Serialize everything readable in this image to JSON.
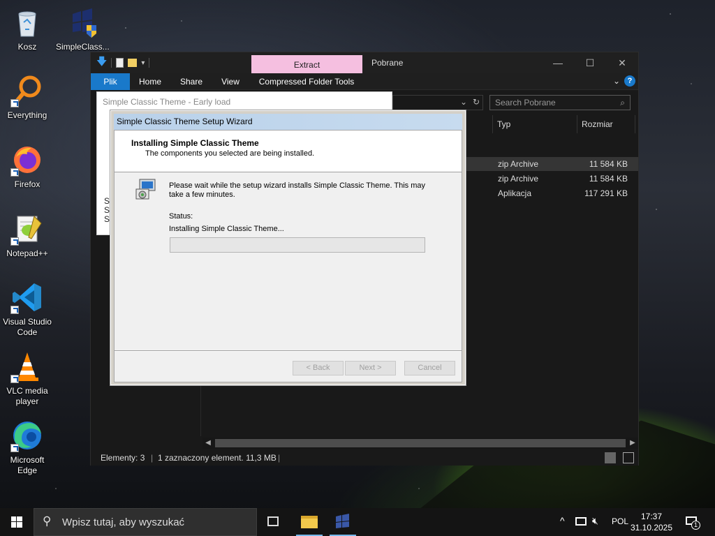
{
  "desktop": {
    "icons": [
      {
        "label": "Kosz"
      },
      {
        "label": "SimpleClass..."
      },
      {
        "label": "Everything"
      },
      {
        "label": "Firefox"
      },
      {
        "label": "Notepad++"
      },
      {
        "label": "Visual Studio Code"
      },
      {
        "label": "VLC media player"
      },
      {
        "label": "Microsoft Edge"
      }
    ]
  },
  "explorer": {
    "title": "Pobrane",
    "contextual_tab": "Extract",
    "ribbon_tabs": [
      "Plik",
      "Home",
      "Share",
      "View",
      "Compressed Folder Tools"
    ],
    "search_placeholder": "Search Pobrane",
    "columns": {
      "type": "Typ",
      "size": "Rozmiar"
    },
    "files": [
      {
        "type": "zip Archive",
        "size": "11 584 KB"
      },
      {
        "type": "zip Archive",
        "size": "11 584 KB"
      },
      {
        "type": "Aplikacja",
        "size": "117 291 KB"
      }
    ],
    "status": {
      "count": "Elementy: 3",
      "selection": "1 zaznaczony element. 11,3 MB"
    }
  },
  "early_load": {
    "title": "Simple Classic Theme - Early load",
    "side_letters": [
      "S",
      "S",
      "S"
    ]
  },
  "wizard": {
    "title": "Simple Classic Theme Setup Wizard",
    "heading": "Installing Simple Classic Theme",
    "subheading": "The components you selected are being installed.",
    "body_line1": "Please wait while the setup wizard installs Simple Classic Theme. This may",
    "body_line2": "take a few minutes.",
    "status_label": "Status:",
    "status_value": "Installing Simple Classic Theme...",
    "progress": 0,
    "buttons": {
      "back": "< Back",
      "next": "Next >",
      "cancel": "Cancel"
    }
  },
  "taskbar": {
    "search_placeholder": "Wpisz tutaj, aby wyszukać",
    "language": "POL",
    "time": "17:37",
    "date": "31.10.2025",
    "notification_count": "1"
  },
  "colors": {
    "accent": "#1979ca",
    "extract_tab": "#f5bfe0",
    "wizard_title": "#b9d1ea"
  }
}
